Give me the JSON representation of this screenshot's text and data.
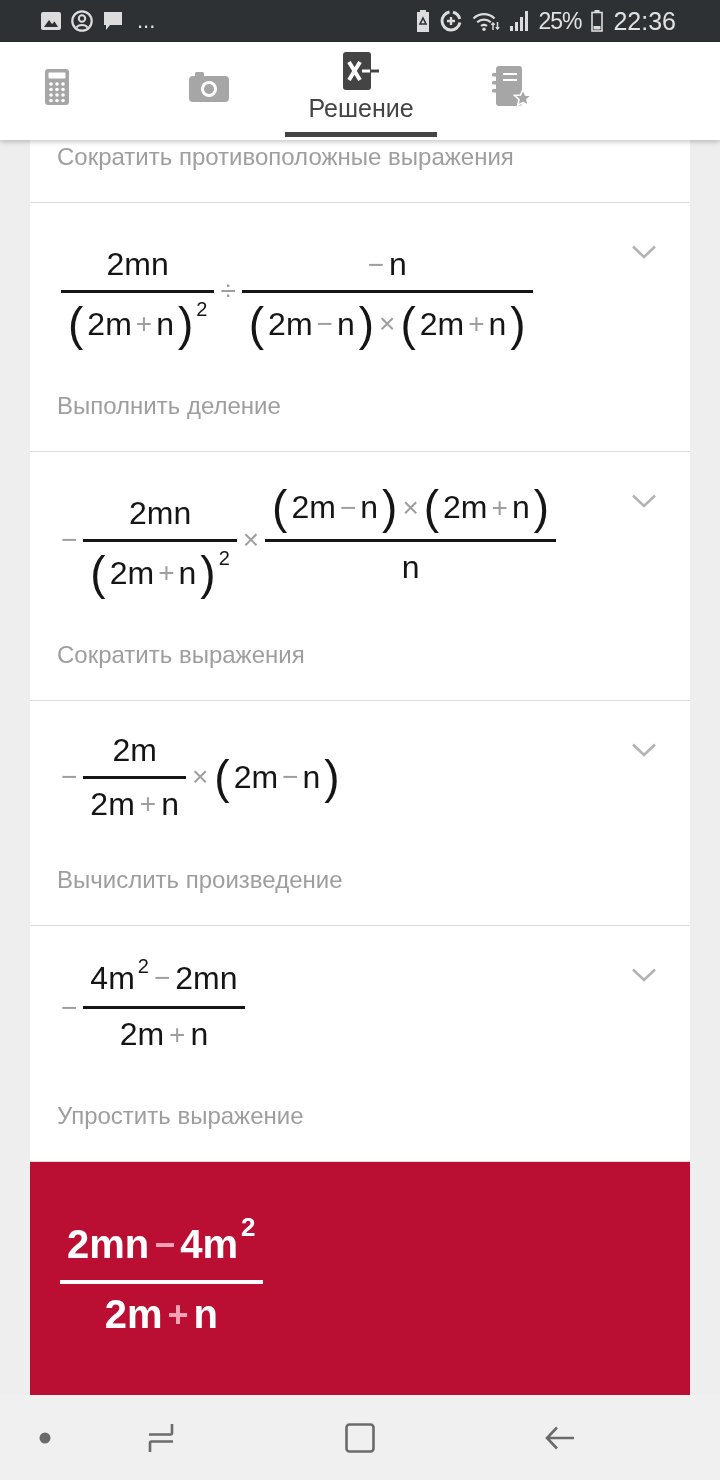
{
  "status_bar": {
    "overflow": "...",
    "battery": "25%",
    "time": "22:36"
  },
  "tabs": [
    {
      "selected": false
    },
    {
      "selected": false
    },
    {
      "label": "Решение",
      "selected": true
    },
    {
      "selected": false
    }
  ],
  "partial_step": {
    "description": "Сократить противоположные выражения"
  },
  "steps": [
    {
      "expanded": false,
      "expression": [
        {
          "kind": "frac",
          "num": [
            {
              "kind": "text",
              "text": "2mn"
            }
          ],
          "den": [
            {
              "kind": "paren",
              "open": "(",
              "close": ")",
              "body": [
                {
                  "kind": "text",
                  "text": "2m"
                },
                {
                  "kind": "op",
                  "text": "+"
                },
                {
                  "kind": "text",
                  "text": "n"
                }
              ]
            },
            {
              "kind": "sup",
              "text": "2"
            }
          ]
        },
        {
          "kind": "op",
          "text": "÷"
        },
        {
          "kind": "frac",
          "num": [
            {
              "kind": "op",
              "text": "−"
            },
            {
              "kind": "text",
              "text": "n"
            }
          ],
          "den": [
            {
              "kind": "paren",
              "open": "(",
              "close": ")",
              "body": [
                {
                  "kind": "text",
                  "text": "2m"
                },
                {
                  "kind": "op",
                  "text": "−"
                },
                {
                  "kind": "text",
                  "text": "n"
                }
              ]
            },
            {
              "kind": "op",
              "text": "×"
            },
            {
              "kind": "paren",
              "open": "(",
              "close": ")",
              "body": [
                {
                  "kind": "text",
                  "text": "2m"
                },
                {
                  "kind": "op",
                  "text": "+"
                },
                {
                  "kind": "text",
                  "text": "n"
                }
              ]
            }
          ]
        }
      ],
      "description": "Выполнить деление"
    },
    {
      "expanded": false,
      "expression": [
        {
          "kind": "op",
          "text": "−"
        },
        {
          "kind": "frac",
          "num": [
            {
              "kind": "text",
              "text": "2mn"
            }
          ],
          "den": [
            {
              "kind": "paren",
              "open": "(",
              "close": ")",
              "body": [
                {
                  "kind": "text",
                  "text": "2m"
                },
                {
                  "kind": "op",
                  "text": "+"
                },
                {
                  "kind": "text",
                  "text": "n"
                }
              ]
            },
            {
              "kind": "sup",
              "text": "2"
            }
          ]
        },
        {
          "kind": "op",
          "text": "×"
        },
        {
          "kind": "frac",
          "num": [
            {
              "kind": "paren",
              "open": "(",
              "close": ")",
              "body": [
                {
                  "kind": "text",
                  "text": "2m"
                },
                {
                  "kind": "op",
                  "text": "−"
                },
                {
                  "kind": "text",
                  "text": "n"
                }
              ]
            },
            {
              "kind": "op",
              "text": "×"
            },
            {
              "kind": "paren",
              "open": "(",
              "close": ")",
              "body": [
                {
                  "kind": "text",
                  "text": "2m"
                },
                {
                  "kind": "op",
                  "text": "+"
                },
                {
                  "kind": "text",
                  "text": "n"
                }
              ]
            }
          ],
          "den": [
            {
              "kind": "text",
              "text": "n"
            }
          ]
        }
      ],
      "description": "Сократить выражения"
    },
    {
      "expanded": false,
      "expression": [
        {
          "kind": "op",
          "text": "−"
        },
        {
          "kind": "frac",
          "num": [
            {
              "kind": "text",
              "text": "2m"
            }
          ],
          "den": [
            {
              "kind": "text",
              "text": "2m"
            },
            {
              "kind": "op",
              "text": "+"
            },
            {
              "kind": "text",
              "text": "n"
            }
          ]
        },
        {
          "kind": "op",
          "text": "×"
        },
        {
          "kind": "paren",
          "open": "(",
          "close": ")",
          "body": [
            {
              "kind": "text",
              "text": "2m"
            },
            {
              "kind": "op",
              "text": "−"
            },
            {
              "kind": "text",
              "text": "n"
            }
          ]
        }
      ],
      "description": "Вычислить произведение"
    },
    {
      "expanded": false,
      "expression": [
        {
          "kind": "op",
          "text": "−"
        },
        {
          "kind": "frac",
          "num": [
            {
              "kind": "text",
              "text": "4m"
            },
            {
              "kind": "sup",
              "text": "2"
            },
            {
              "kind": "op",
              "text": "−"
            },
            {
              "kind": "text",
              "text": "2mn"
            }
          ],
          "den": [
            {
              "kind": "text",
              "text": "2m"
            },
            {
              "kind": "op",
              "text": "+"
            },
            {
              "kind": "text",
              "text": "n"
            }
          ]
        }
      ],
      "description": "Упростить выражение"
    }
  ],
  "result": {
    "expression": [
      {
        "kind": "frac",
        "num": [
          {
            "kind": "text",
            "text": "2mn"
          },
          {
            "kind": "op",
            "text": "−"
          },
          {
            "kind": "text",
            "text": "4m"
          },
          {
            "kind": "sup",
            "text": "2"
          }
        ],
        "den": [
          {
            "kind": "text",
            "text": "2m"
          },
          {
            "kind": "op",
            "text": "+"
          },
          {
            "kind": "text",
            "text": "n"
          }
        ]
      }
    ]
  }
}
